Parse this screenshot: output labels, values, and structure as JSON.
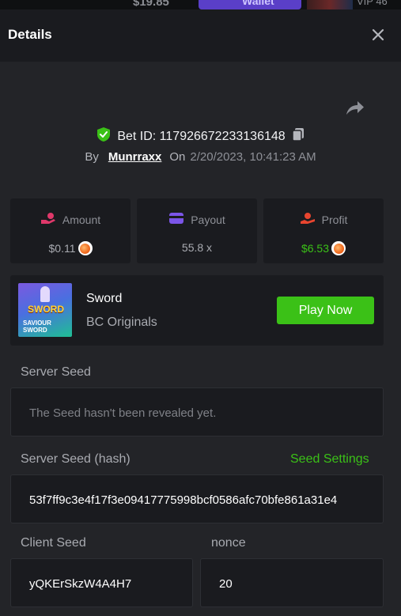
{
  "top_strip": {
    "balance": "$19.85",
    "wallet_label": "Wallet",
    "vip_label": "VIP 46"
  },
  "header": {
    "title": "Details"
  },
  "bet": {
    "id_label": "Bet ID: 117926672233136148",
    "by_label": "By",
    "user": "Munrraxx",
    "on_label": "On",
    "date": "2/20/2023, 10:41:23 AM"
  },
  "stats": [
    {
      "label": "Amount",
      "value": "$0.11"
    },
    {
      "label": "Payout",
      "value": "55.8 x"
    },
    {
      "label": "Profit",
      "value": "$6.53"
    }
  ],
  "game": {
    "name": "Sword",
    "provider": "BC Originals",
    "play_label": "Play Now",
    "thumb_title": "SWORD",
    "thumb_subtitle": "SAVIOUR SWORD"
  },
  "server_seed": {
    "label": "Server Seed",
    "value": "The Seed hasn't been revealed yet."
  },
  "server_seed_hash": {
    "label": "Server Seed (hash)",
    "settings_label": "Seed Settings",
    "value": "53f7ff9c3e4f17f3e09417775998bcf0586afc70bfe861a31e4"
  },
  "client_seed": {
    "label": "Client Seed",
    "value": "yQKErSkzW4A4H7"
  },
  "nonce": {
    "label": "nonce",
    "value": "20"
  },
  "colors": {
    "accent_green": "#3bc117",
    "wallet_purple": "#5a3fc8",
    "amount_icon": "#e0386a",
    "payout_icon": "#7b55e8",
    "profit_icon": "#e8452f"
  }
}
